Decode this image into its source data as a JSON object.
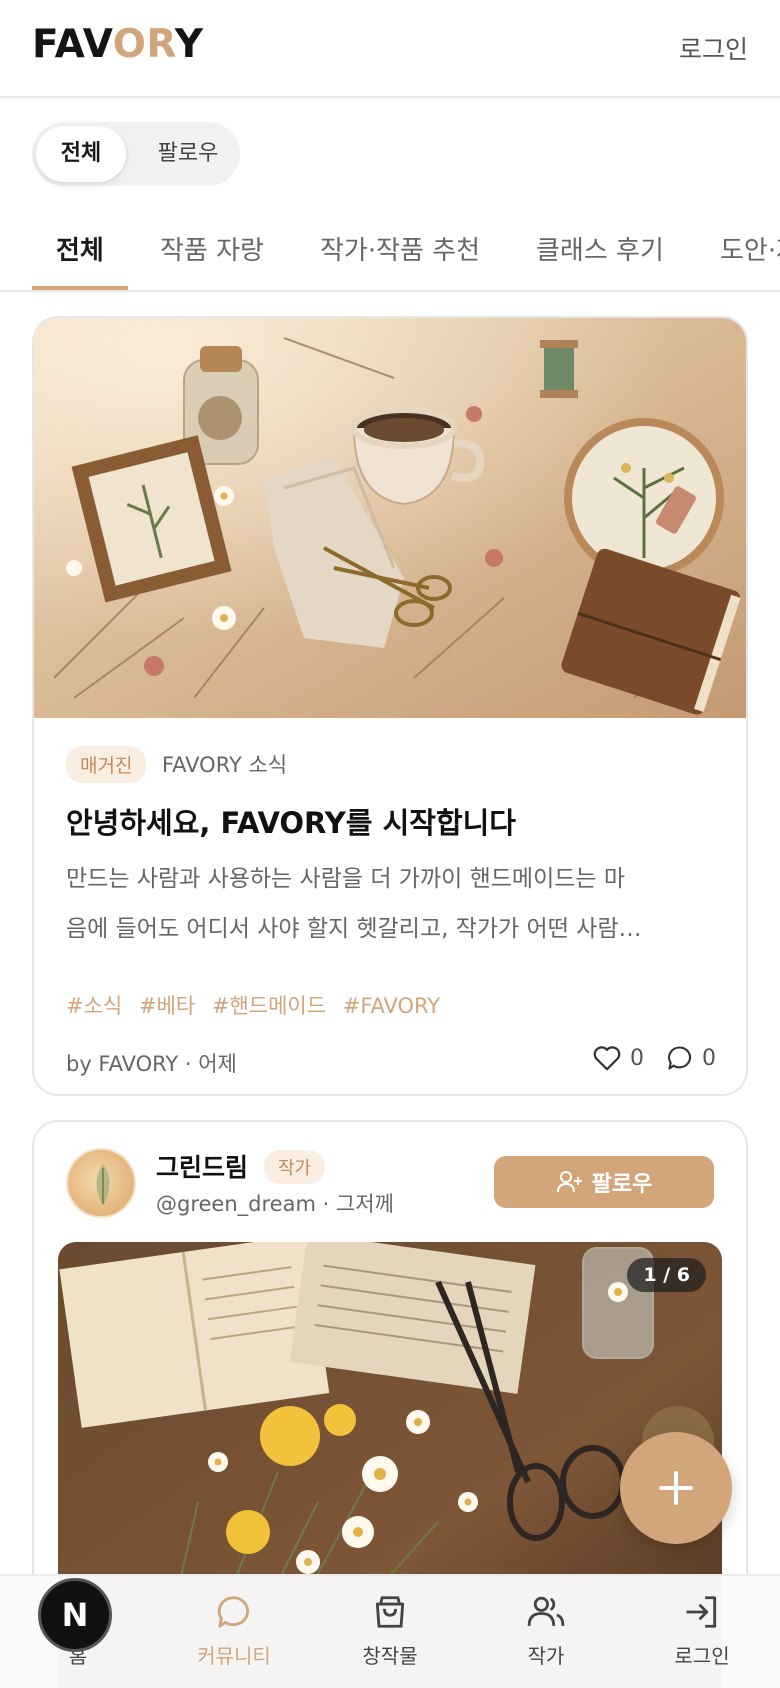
{
  "header": {
    "logo_part1": "FAV",
    "logo_part2": "OR",
    "logo_part3": "Y",
    "login_label": "로그인"
  },
  "segment": {
    "options": [
      "전체",
      "팔로우"
    ],
    "selected": "전체"
  },
  "tabs": {
    "items": [
      "전체",
      "작품 자랑",
      "작가·작품 추천",
      "클래스 후기",
      "도안·자"
    ],
    "active": "전체"
  },
  "feed": {
    "post1": {
      "badge": "매거진",
      "category": "FAVORY 소식",
      "title": "안녕하세요, FAVORY를 시작합니다",
      "excerpt_line1": "만드는 사람과 사용하는 사람을 더 가까이 핸드메이드는 마",
      "excerpt_line2": "음에 들어도 어디서 사야 할지 헷갈리고, 작가가 어떤 사람…",
      "tags": [
        "#소식",
        "#베타",
        "#핸드메이드",
        "#FAVORY"
      ],
      "byline": "by FAVORY · 어제",
      "likes": "0",
      "comments": "0"
    },
    "post2": {
      "author_name": "그린드림",
      "author_badge": "작가",
      "author_meta": "@green_dream · 그저께",
      "follow_label": "팔로우",
      "image_counter": "1 / 6"
    }
  },
  "bottom_nav": {
    "items": [
      "홈",
      "커뮤니티",
      "창작물",
      "작가",
      "로그인"
    ],
    "active": "커뮤니티",
    "next_badge": "N"
  },
  "colors": {
    "accent": "#d2a57a",
    "badge_bg": "#faeee3"
  }
}
